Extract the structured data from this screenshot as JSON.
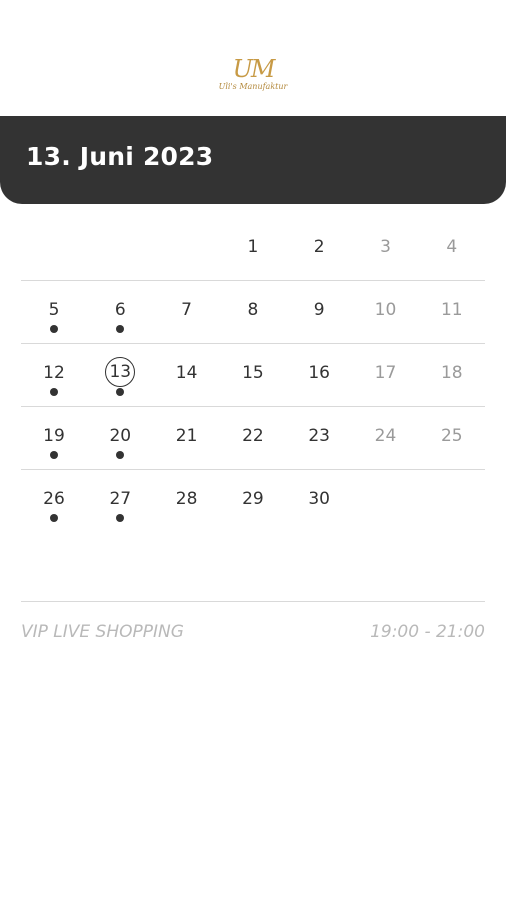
{
  "logo": {
    "mark": "UM",
    "subtitle": "Uli's Manufaktur"
  },
  "header": {
    "date_title": "13. Juni 2023"
  },
  "calendar": {
    "weeks": [
      [
        {
          "day": ""
        },
        {
          "day": ""
        },
        {
          "day": ""
        },
        {
          "day": "1"
        },
        {
          "day": "2"
        },
        {
          "day": "3"
        },
        {
          "day": "4"
        }
      ],
      [
        {
          "day": "5"
        },
        {
          "day": "6"
        },
        {
          "day": "7"
        },
        {
          "day": "8"
        },
        {
          "day": "9"
        },
        {
          "day": "10"
        },
        {
          "day": "11"
        }
      ],
      [
        {
          "day": "12"
        },
        {
          "day": "13"
        },
        {
          "day": "14"
        },
        {
          "day": "15"
        },
        {
          "day": "16"
        },
        {
          "day": "17"
        },
        {
          "day": "18"
        }
      ],
      [
        {
          "day": "19"
        },
        {
          "day": "20"
        },
        {
          "day": "21"
        },
        {
          "day": "22"
        },
        {
          "day": "23"
        },
        {
          "day": "24"
        },
        {
          "day": "25"
        }
      ],
      [
        {
          "day": "26"
        },
        {
          "day": "27"
        },
        {
          "day": "28"
        },
        {
          "day": "29"
        },
        {
          "day": "30"
        },
        {
          "day": ""
        },
        {
          "day": ""
        }
      ]
    ],
    "event_days": [
      "5",
      "6",
      "12",
      "13",
      "19",
      "20",
      "26",
      "27"
    ],
    "selected_day": "13"
  },
  "event": {
    "name": "VIP LIVE SHOPPING",
    "time": "19:00 - 21:00"
  },
  "colors": {
    "header_bg": "#333333",
    "logo_gold": "#c79a45",
    "weekend_text": "#9a9a9a",
    "event_text": "#b9b9b9"
  }
}
